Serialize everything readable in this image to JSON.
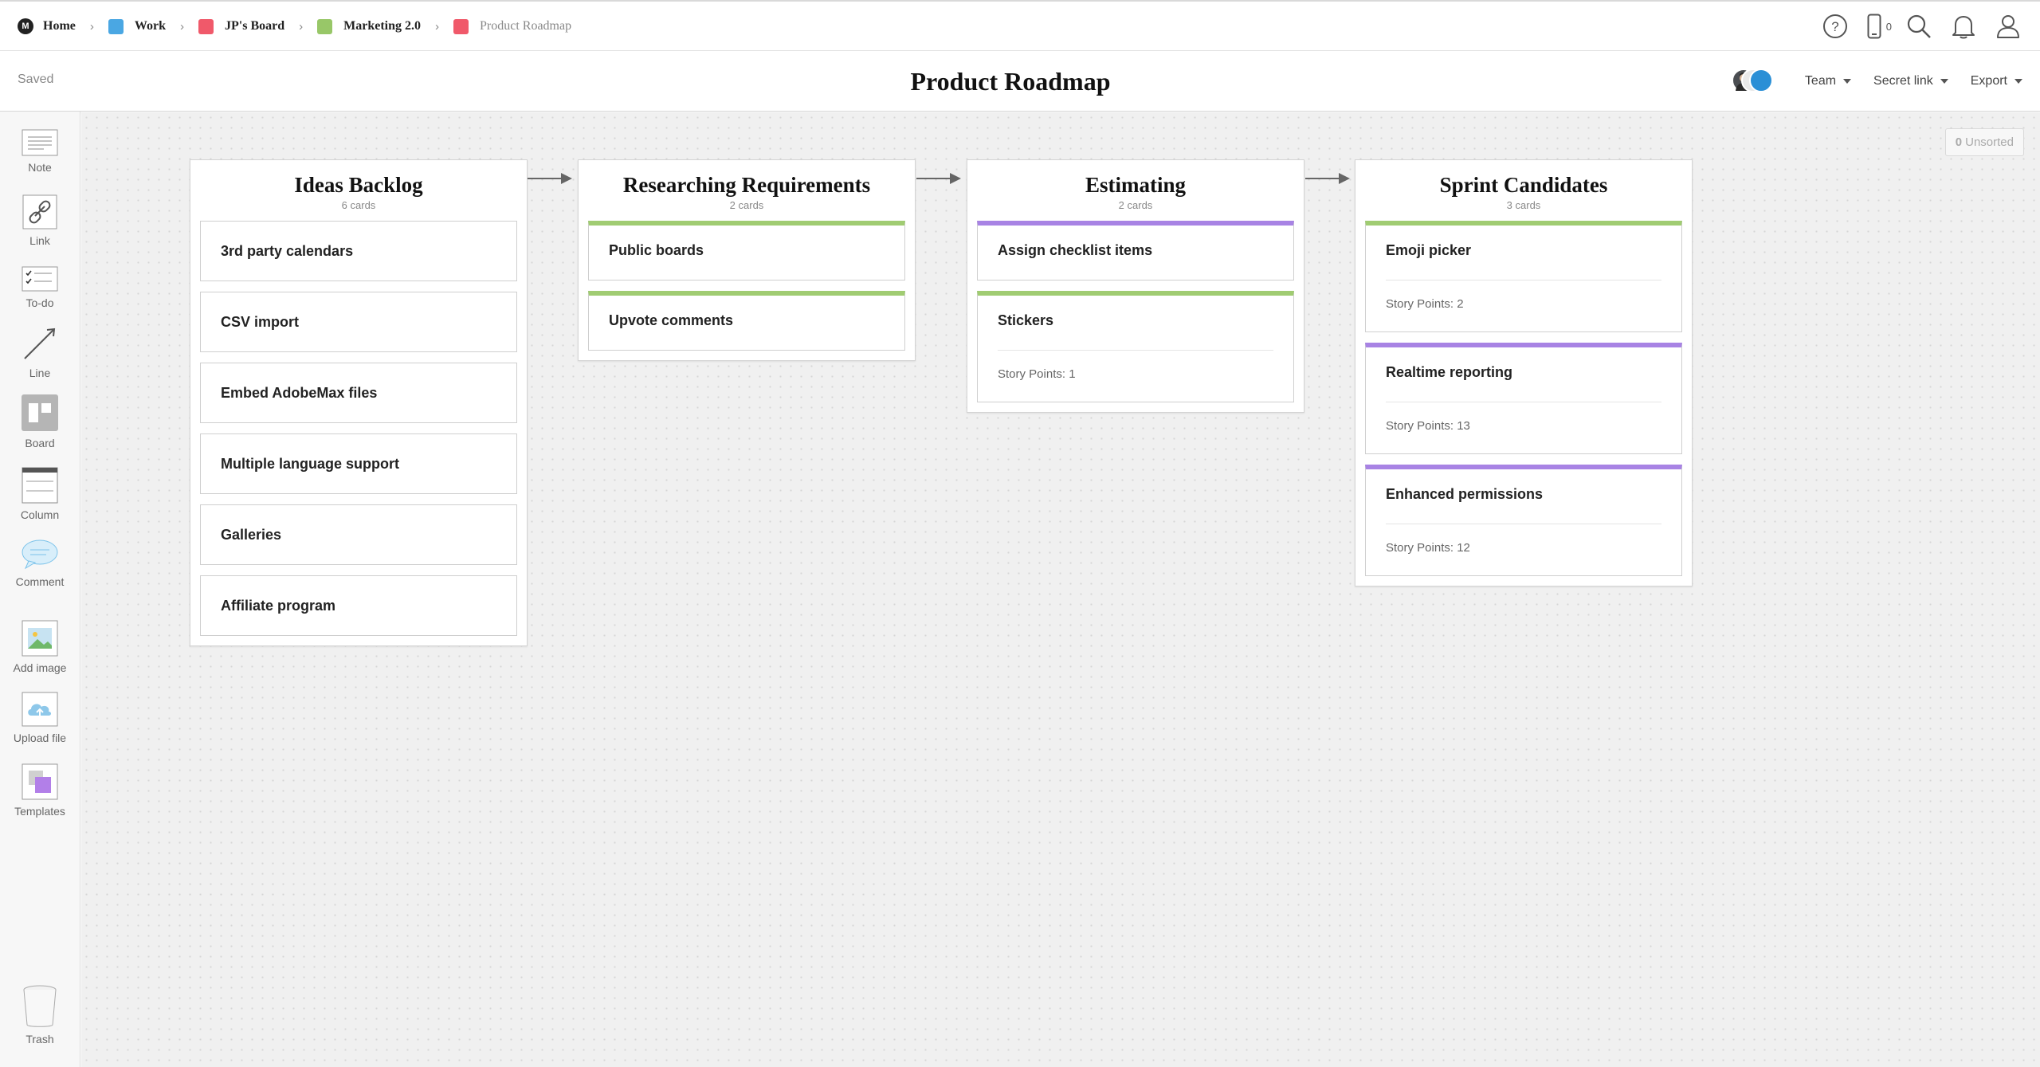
{
  "breadcrumb": [
    {
      "label": "Home",
      "color": "#222222",
      "type": "logo"
    },
    {
      "label": "Work",
      "color": "#4aa7e3",
      "type": "square"
    },
    {
      "label": "JP's Board",
      "color": "#f0596a",
      "type": "square"
    },
    {
      "label": "Marketing 2.0",
      "color": "#98c768",
      "type": "square"
    },
    {
      "label": "Product Roadmap",
      "color": "#f0596a",
      "type": "square",
      "current": true
    }
  ],
  "topbar": {
    "help_icon": "help-circle-icon",
    "phone_icon": "phone-icon",
    "phone_count": "0",
    "search_icon": "search-icon",
    "notifications_icon": "bell-icon",
    "profile_icon": "user-icon"
  },
  "header": {
    "status": "Saved",
    "title": "Product Roadmap",
    "team_label": "Team",
    "secret_link_label": "Secret link",
    "export_label": "Export"
  },
  "sidebar": {
    "tools": [
      {
        "label": "Note",
        "icon": "note-icon"
      },
      {
        "label": "Link",
        "icon": "link-icon"
      },
      {
        "label": "To-do",
        "icon": "todo-icon"
      },
      {
        "label": "Line",
        "icon": "line-icon"
      },
      {
        "label": "Board",
        "icon": "board-icon"
      },
      {
        "label": "Column",
        "icon": "column-icon"
      },
      {
        "label": "Comment",
        "icon": "comment-icon"
      },
      {
        "label": "Add image",
        "icon": "image-icon"
      },
      {
        "label": "Upload file",
        "icon": "upload-cloud-icon"
      },
      {
        "label": "Templates",
        "icon": "templates-icon"
      },
      {
        "label": "Trash",
        "icon": "trash-icon"
      }
    ]
  },
  "canvas": {
    "unsorted_count": "0",
    "unsorted_label": "Unsorted"
  },
  "columns": [
    {
      "title": "Ideas Backlog",
      "count": "6 cards",
      "cards": [
        {
          "title": "3rd party calendars"
        },
        {
          "title": "CSV import"
        },
        {
          "title": "Embed AdobeMax files"
        },
        {
          "title": "Multiple language support"
        },
        {
          "title": "Galleries"
        },
        {
          "title": "Affiliate program"
        }
      ]
    },
    {
      "title": "Researching Requirements",
      "count": "2 cards",
      "cards": [
        {
          "title": "Public boards",
          "color": "green"
        },
        {
          "title": "Upvote comments",
          "color": "green"
        }
      ]
    },
    {
      "title": "Estimating",
      "count": "2 cards",
      "cards": [
        {
          "title": "Assign checklist items",
          "color": "purple"
        },
        {
          "title": "Stickers",
          "color": "green",
          "meta": "Story Points: 1"
        }
      ]
    },
    {
      "title": "Sprint Candidates",
      "count": "3 cards",
      "cards": [
        {
          "title": "Emoji picker",
          "color": "green",
          "meta": "Story Points: 2"
        },
        {
          "title": "Realtime reporting",
          "color": "purple",
          "meta": "Story Points: 13"
        },
        {
          "title": "Enhanced permissions",
          "color": "purple",
          "meta": "Story Points: 12"
        }
      ]
    }
  ],
  "colors": {
    "green_tag": "#a0cc72",
    "purple_tag": "#a883e4"
  }
}
